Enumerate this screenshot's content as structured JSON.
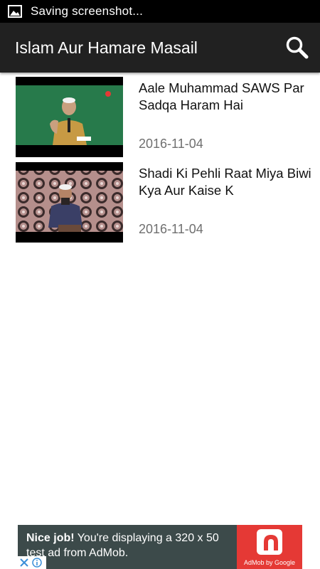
{
  "status_bar": {
    "notification_icon": "image-icon",
    "text": "Saving screenshot..."
  },
  "app_bar": {
    "title": "Islam Aur Hamare Masail",
    "search_icon": "search-icon"
  },
  "videos": [
    {
      "title": "Aale Muhammad SAWS Par Sadqa Haram Hai",
      "date": "2016-11-04",
      "thumbnail_icon": "video-thumbnail"
    },
    {
      "title": "Shadi Ki Pehli Raat Miya Biwi Kya Aur Kaise K",
      "date": "2016-11-04",
      "thumbnail_icon": "video-thumbnail"
    }
  ],
  "ad": {
    "headline": "Nice job!",
    "body": " You're displaying a 320 x 50 test ad from AdMob.",
    "logo_caption": "AdMob by Google",
    "close_icon": "close-icon",
    "info_icon": "info-icon"
  },
  "colors": {
    "app_bar": "#212121",
    "status_bar": "#000000",
    "date_text": "#6f6f6f",
    "ad_background": "#3c4a4a",
    "ad_logo": "#e53935"
  }
}
